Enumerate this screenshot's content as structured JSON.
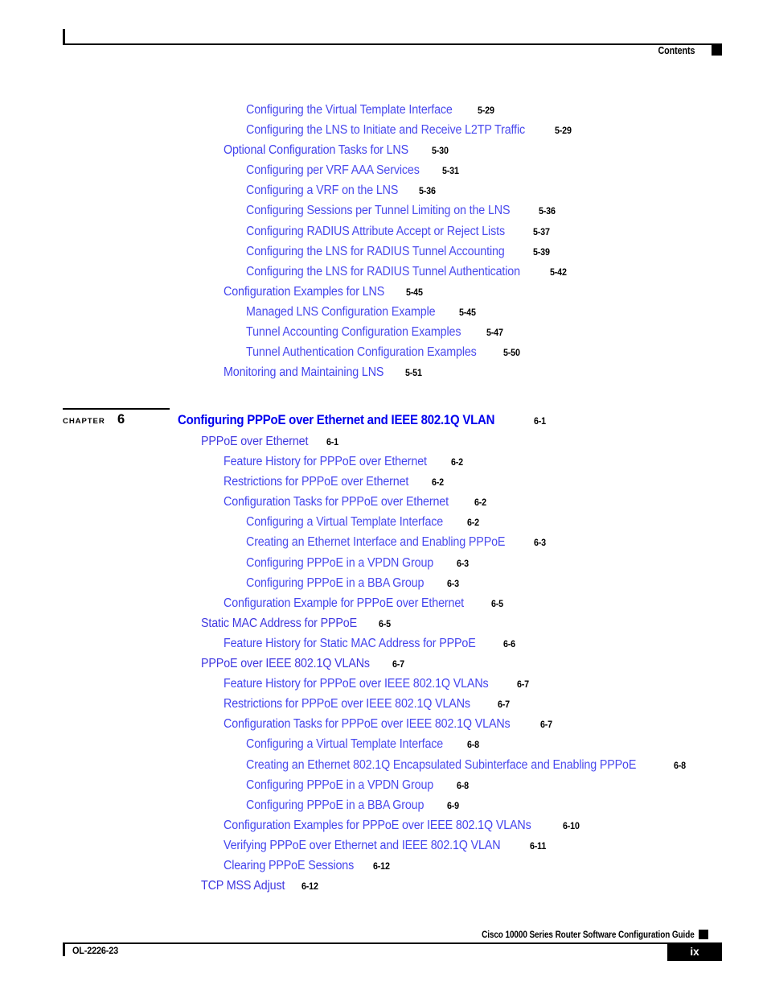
{
  "header": {
    "label": "Contents"
  },
  "toc": {
    "entries": [
      {
        "level": 3,
        "title": "Configuring the Virtual Template Interface",
        "page": "5-29"
      },
      {
        "level": 3,
        "title": "Configuring the LNS to Initiate and Receive L2TP Traffic",
        "page": "5-29"
      },
      {
        "level": 2,
        "title": "Optional Configuration Tasks for LNS",
        "page": "5-30"
      },
      {
        "level": 3,
        "title": "Configuring per VRF AAA Services",
        "page": "5-31"
      },
      {
        "level": 3,
        "title": "Configuring a VRF on the LNS",
        "page": "5-36"
      },
      {
        "level": 3,
        "title": "Configuring Sessions per Tunnel Limiting on the LNS",
        "page": "5-36"
      },
      {
        "level": 3,
        "title": "Configuring RADIUS Attribute Accept or Reject Lists",
        "page": "5-37"
      },
      {
        "level": 3,
        "title": "Configuring the LNS for RADIUS Tunnel Accounting",
        "page": "5-39"
      },
      {
        "level": 3,
        "title": "Configuring the LNS for RADIUS Tunnel Authentication",
        "page": "5-42"
      },
      {
        "level": 2,
        "title": "Configuration Examples for LNS",
        "page": "5-45"
      },
      {
        "level": 3,
        "title": "Managed LNS Configuration Example",
        "page": "5-45"
      },
      {
        "level": 3,
        "title": "Tunnel Accounting Configuration Examples",
        "page": "5-47"
      },
      {
        "level": 3,
        "title": "Tunnel Authentication Configuration Examples",
        "page": "5-50"
      },
      {
        "level": 2,
        "title": "Monitoring and Maintaining LNS",
        "page": "5-51"
      }
    ]
  },
  "chapter": {
    "word": "Chapter",
    "number": "6",
    "title": "Configuring PPPoE over Ethernet and IEEE 802.1Q VLAN",
    "page": "6-1"
  },
  "toc2": {
    "entries": [
      {
        "level": 1,
        "title": "PPPoE over Ethernet",
        "page": "6-1"
      },
      {
        "level": 2,
        "title": "Feature History for PPPoE over Ethernet",
        "page": "6-2"
      },
      {
        "level": 2,
        "title": "Restrictions for PPPoE over Ethernet",
        "page": "6-2"
      },
      {
        "level": 2,
        "title": "Configuration Tasks for PPPoE over Ethernet",
        "page": "6-2"
      },
      {
        "level": 3,
        "title": "Configuring a Virtual Template Interface",
        "page": "6-2"
      },
      {
        "level": 3,
        "title": "Creating an Ethernet Interface and Enabling PPPoE",
        "page": "6-3"
      },
      {
        "level": 3,
        "title": "Configuring PPPoE in a VPDN Group",
        "page": "6-3"
      },
      {
        "level": 3,
        "title": "Configuring PPPoE in a BBA Group",
        "page": "6-3"
      },
      {
        "level": 2,
        "title": "Configuration Example for PPPoE over Ethernet",
        "page": "6-5"
      },
      {
        "level": 1,
        "title": "Static MAC Address for PPPoE",
        "page": "6-5"
      },
      {
        "level": 2,
        "title": "Feature History for Static MAC Address for PPPoE",
        "page": "6-6"
      },
      {
        "level": 1,
        "title": "PPPoE over IEEE 802.1Q VLANs",
        "page": "6-7"
      },
      {
        "level": 2,
        "title": "Feature History for PPPoE over IEEE 802.1Q VLANs",
        "page": "6-7"
      },
      {
        "level": 2,
        "title": "Restrictions for PPPoE over IEEE 802.1Q VLANs",
        "page": "6-7"
      },
      {
        "level": 2,
        "title": "Configuration Tasks for PPPoE over IEEE 802.1Q VLANs",
        "page": "6-7"
      },
      {
        "level": 3,
        "title": "Configuring a Virtual Template Interface",
        "page": "6-8"
      },
      {
        "level": 3,
        "title": "Creating an Ethernet 802.1Q Encapsulated Subinterface and Enabling PPPoE",
        "page": "6-8"
      },
      {
        "level": 3,
        "title": "Configuring PPPoE in a VPDN Group",
        "page": "6-8"
      },
      {
        "level": 3,
        "title": "Configuring PPPoE in a BBA Group",
        "page": "6-9"
      },
      {
        "level": 2,
        "title": "Configuration Examples for PPPoE over IEEE 802.1Q VLANs",
        "page": "6-10"
      },
      {
        "level": 2,
        "title": "Verifying PPPoE over Ethernet and IEEE 802.1Q VLAN",
        "page": "6-11"
      },
      {
        "level": 2,
        "title": "Clearing PPPoE Sessions",
        "page": "6-12"
      },
      {
        "level": 1,
        "title": "TCP MSS Adjust",
        "page": "6-12"
      }
    ]
  },
  "footer": {
    "guide": "Cisco 10000 Series Router Software Configuration Guide",
    "doc_id": "OL-2226-23",
    "page_number": "ix"
  },
  "colors": {
    "link_blue": "#4040e8",
    "chapter_blue": "#0000ee",
    "text_black": "#000000"
  }
}
